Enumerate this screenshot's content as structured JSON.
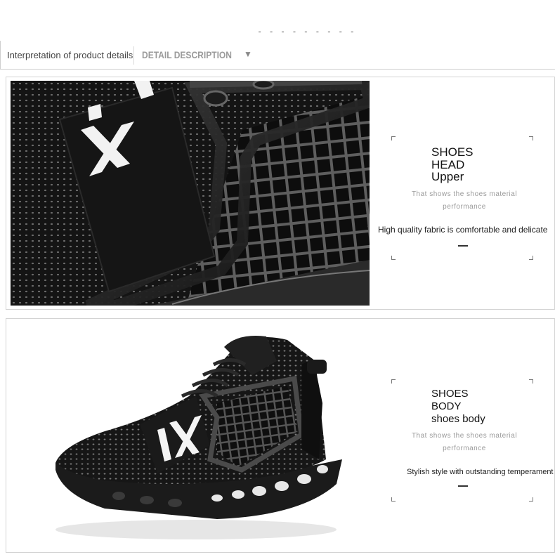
{
  "header": {
    "decoration": "- - - - - - - - -",
    "title": "Interpretation of product details",
    "subtitle": "DETAIL DESCRIPTION",
    "arrow": "▼"
  },
  "sections": [
    {
      "image": "shoe-upper-closeup-photo",
      "heading_lines": [
        "SHOES",
        "HEAD",
        "Upper"
      ],
      "caption_line1": "That shows the shoes material",
      "caption_line2": "performance",
      "description": "High quality fabric is comfortable and delicate"
    },
    {
      "image": "shoe-side-view-photo",
      "heading_lines": [
        "SHOES",
        "BODY",
        "shoes body"
      ],
      "caption_line1": "That shows the shoes material",
      "caption_line2": "performance",
      "description": "Stylish style with outstanding temperament"
    }
  ],
  "colors": {
    "border": "#d3d3d3",
    "shoe": "#121212",
    "text": "#222222",
    "muted": "#9a9a9a"
  }
}
